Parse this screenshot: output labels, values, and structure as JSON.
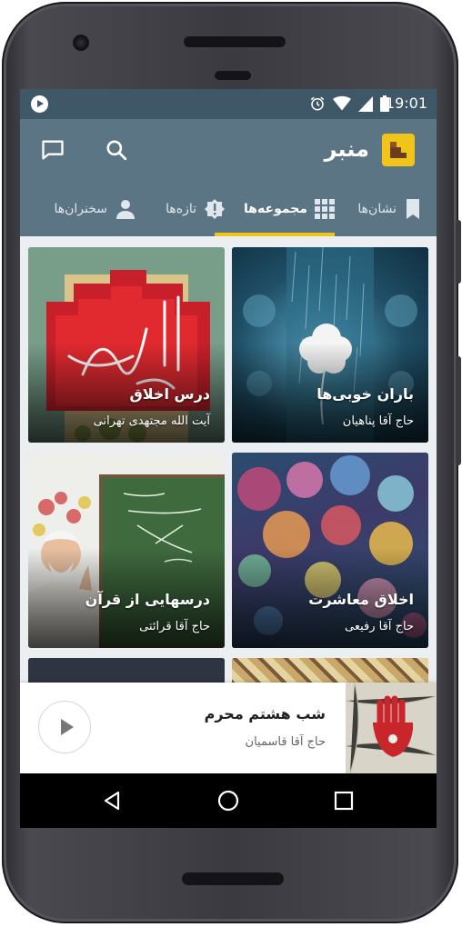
{
  "status_bar": {
    "time": "19:01",
    "icons": [
      "play-notification-icon",
      "alarm-icon",
      "wifi-icon",
      "signal-icon",
      "battery-icon"
    ]
  },
  "app_bar": {
    "title": "منبر",
    "actions": [
      "search-icon",
      "chat-icon"
    ]
  },
  "tabs": [
    {
      "label": "نشان‌ها",
      "icon": "bookmark-icon",
      "selected": false
    },
    {
      "label": "مجموعه‌ها",
      "icon": "grid-icon",
      "selected": true
    },
    {
      "label": "تازه‌ها",
      "icon": "new-badge-icon",
      "selected": false
    },
    {
      "label": "سخنران‌ها",
      "icon": "person-icon",
      "selected": false
    }
  ],
  "collections": [
    {
      "title": "باران خوبی‌ها",
      "speaker": "حاج آقا پناهیان"
    },
    {
      "title": "درس اخلاق",
      "speaker": "آیت الله مجتهدی تهرانی"
    },
    {
      "title": "اخلاق معاشرت",
      "speaker": "حاج آقا رفیعی"
    },
    {
      "title": "درسهایی از قرآن",
      "speaker": "حاج آقا قرائتی"
    }
  ],
  "now_playing": {
    "title": "شب هشتم محرم",
    "speaker": "حاج آقا قاسمیان"
  },
  "colors": {
    "status_bar": "#3e5868",
    "app_bar": "#5b7585",
    "accent": "#f0c419",
    "screen_bg": "#eceff1"
  }
}
